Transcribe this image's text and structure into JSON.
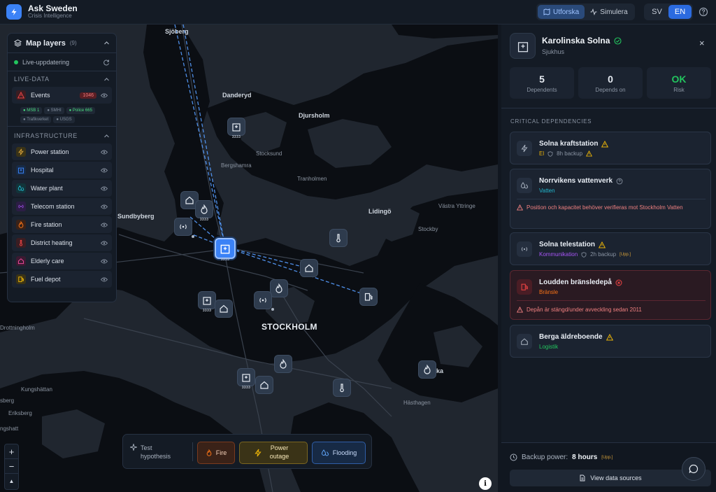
{
  "app": {
    "title": "Ask Sweden",
    "subtitle": "Crisis Intelligence"
  },
  "modes": {
    "explore": "Utforska",
    "simulate": "Simulera"
  },
  "languages": {
    "sv": "SV",
    "en": "EN",
    "active": "EN"
  },
  "map": {
    "places": {
      "sjoberg": "Sjöberg",
      "danderyd": "Danderyd",
      "djursholm": "Djursholm",
      "stocksund": "Stocksund",
      "bergshamra": "Bergshamra",
      "tranholmen": "Tranholmen",
      "sundbyberg": "Sundbyberg",
      "lidingo": "Lidingö",
      "vastra_yttringe": "Västra Yttringe",
      "stockby": "Stockby",
      "stockholm": "STOCKHOLM",
      "drottningholm": "Drottningholm",
      "kungshattan": "Kungshättan",
      "sberg": "sberg",
      "eriksberg": "Eriksberg",
      "ngshatt": "ngshatt",
      "hasthagen": "Hästhagen",
      "ka": "ka"
    },
    "pin_tag": "3333",
    "info": "i"
  },
  "layers": {
    "title": "Map layers",
    "count": "(9)",
    "live_update": "Live-uppdatering",
    "live_data_header": "LIVE-DATA",
    "events": {
      "label": "Events",
      "count": "1046"
    },
    "sources": {
      "msb": "MSB 1",
      "smhi": "SMHI",
      "police": "Police 665",
      "trafikverket": "Trafikverket",
      "usgs": "USGS"
    },
    "infrastructure_header": "INFRASTRUCTURE",
    "items": [
      {
        "label": "Power station",
        "color": "#d6a13a"
      },
      {
        "label": "Hospital",
        "color": "#3b82f6"
      },
      {
        "label": "Water plant",
        "color": "#22b8cf"
      },
      {
        "label": "Telecom station",
        "color": "#a855f7"
      },
      {
        "label": "Fire station",
        "color": "#f97316"
      },
      {
        "label": "District heating",
        "color": "#ef4444"
      },
      {
        "label": "Elderly care",
        "color": "#ec4899"
      },
      {
        "label": "Fuel depot",
        "color": "#eab308"
      }
    ]
  },
  "zoom": {
    "in": "+",
    "out": "−",
    "north": "▲"
  },
  "hypothesis": {
    "label": "Test hypothesis",
    "fire": "Fire",
    "power": "Power outage",
    "flooding": "Flooding"
  },
  "panel": {
    "name": "Karolinska Solna",
    "type": "Sjukhus",
    "close": "×",
    "stats": [
      {
        "value": "5",
        "label": "Dependents"
      },
      {
        "value": "0",
        "label": "Depends on"
      },
      {
        "value": "OK",
        "label": "Risk"
      }
    ],
    "deps_header": "CRITICAL DEPENDENCIES",
    "deps": [
      {
        "name": "Solna kraftstation",
        "category": "El",
        "backup": "8h backup"
      },
      {
        "name": "Norrvikens vattenverk",
        "category": "Vatten",
        "warning": "Position och kapacitet behöver verifieras mot Stockholm Vatten"
      },
      {
        "name": "Solna telestation",
        "category": "Kommunikation",
        "backup": "2h backup",
        "tag": "[Upp.]"
      },
      {
        "name": "Loudden bränsledepå",
        "category": "Bränsle",
        "warning": "Depån är stängd/under avveckling sedan 2011"
      },
      {
        "name": "Berga äldreboende",
        "category": "Logistik"
      }
    ],
    "backup_label": "Backup power:",
    "backup_value": "8 hours",
    "backup_tag": "[Upp.]",
    "view_sources": "View data sources"
  },
  "colors": {
    "accent": "#3b82f6",
    "ok": "#22c55e",
    "warning": "#eab308",
    "danger": "#ef4444"
  }
}
